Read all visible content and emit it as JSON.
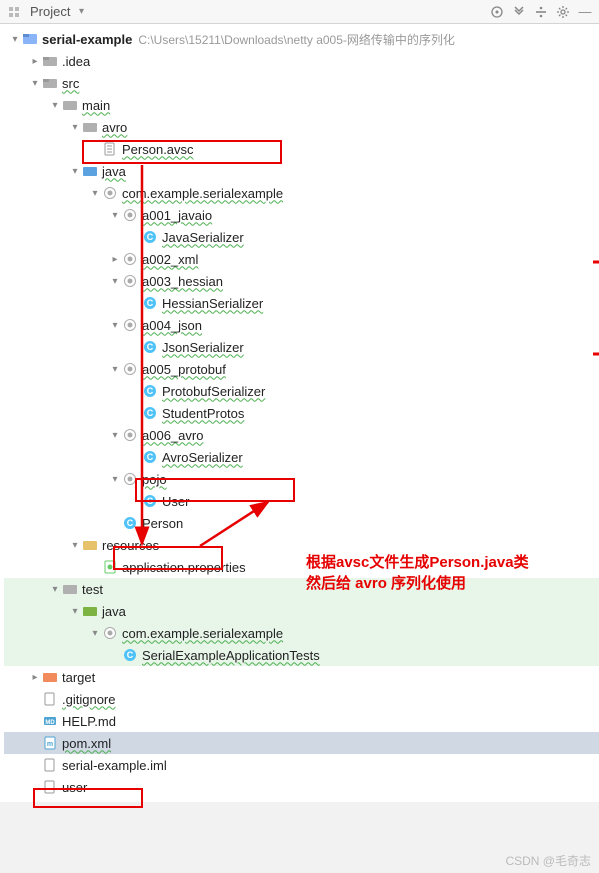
{
  "toolbar": {
    "title": "Project"
  },
  "root": {
    "name": "serial-example",
    "path": "C:\\Users\\15211\\Downloads\\netty a005-网络传输中的序列化"
  },
  "idea": ".idea",
  "src": "src",
  "main": "main",
  "avro": "avro",
  "personAvsc": "Person.avsc",
  "java": "java",
  "pkg": "com.example.serialexample",
  "a001": "a001_javaio",
  "javaSerializer": "JavaSerializer",
  "a002": "a002_xml",
  "a003": "a003_hessian",
  "hessianSerializer": "HessianSerializer",
  "a004": "a004_json",
  "jsonSerializer": "JsonSerializer",
  "a005": "a005_protobuf",
  "protobufSerializer": "ProtobufSerializer",
  "studentProtos": "StudentProtos",
  "a006": "a006_avro",
  "avroSerializer": "AvroSerializer",
  "pojo": "pojo",
  "user": "User",
  "person": "Person",
  "resources": "resources",
  "appProps": "application.properties",
  "test": "test",
  "testJava": "java",
  "testPkg": "com.example.serialexample",
  "testClass": "SerialExampleApplicationTests",
  "target": "target",
  "gitignore": ".gitignore",
  "helpMd": "HELP.md",
  "pomXml": "pom.xml",
  "iml": "serial-example.iml",
  "userFile": "user",
  "annotation": {
    "line1": "根据avsc文件生成Person.java类",
    "line2": "然后给 avro 序列化使用"
  },
  "watermark": "CSDN @毛奇志"
}
